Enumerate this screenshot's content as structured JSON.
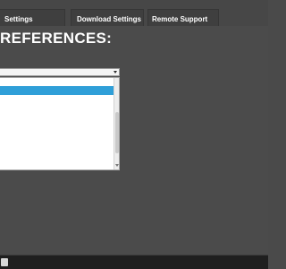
{
  "nav": {
    "tabs": [
      {
        "label": "Settings"
      },
      {
        "label": "Download Settings"
      },
      {
        "label": "Remote Support"
      }
    ]
  },
  "page": {
    "title": "REFERENCES:"
  },
  "icons": {
    "combo_arrow": "chevron-down-icon",
    "scroll_down": "arrow-down-icon",
    "taskbar_app": "app-icon"
  },
  "colors": {
    "background": "#4b4b4b",
    "nav_tab": "#3f3f3f",
    "selection": "#2f9fd8",
    "taskbar": "#1f1f1f"
  }
}
